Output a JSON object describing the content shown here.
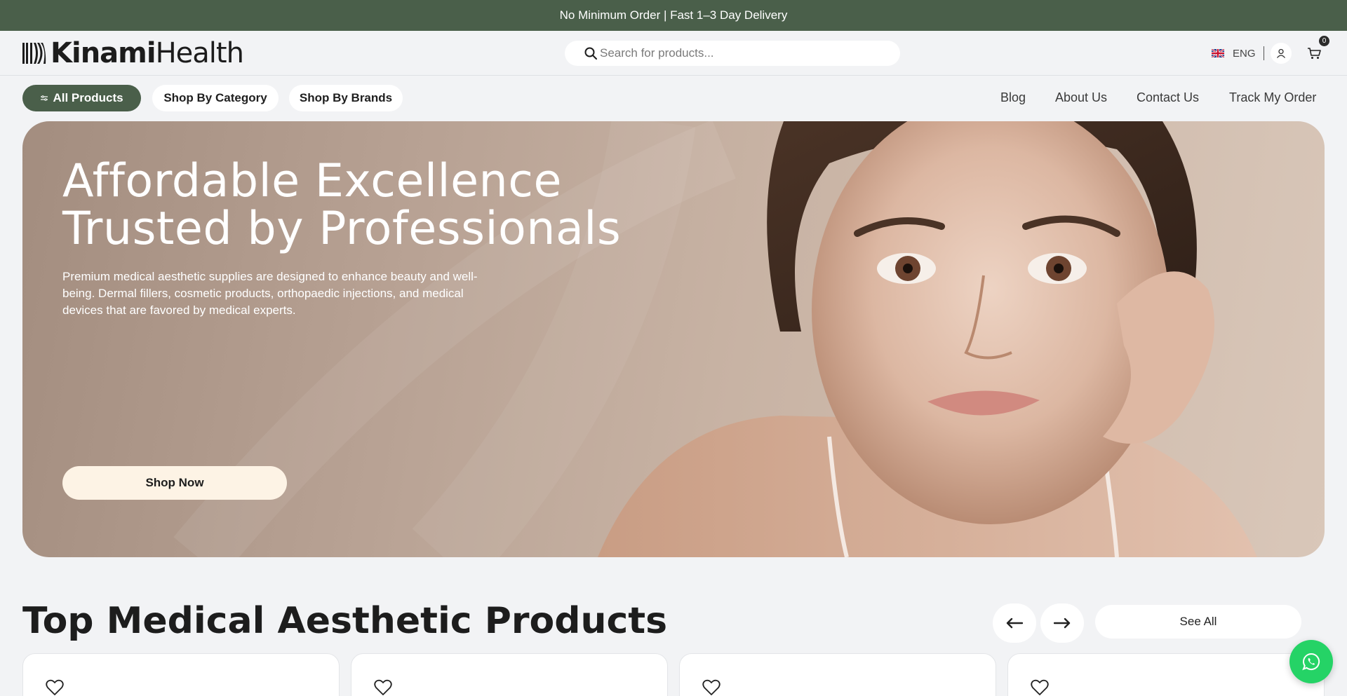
{
  "announcement": {
    "text": "No Minimum Order | Fast 1–3 Day Delivery"
  },
  "header": {
    "logo": {
      "bold": "Kinami",
      "regular": "Health"
    },
    "search": {
      "placeholder": "Search for products...",
      "value": ""
    },
    "language": {
      "label": "ENG",
      "flag_icon": "uk-flag-icon"
    },
    "user_icon": "user-icon",
    "cart": {
      "icon": "cart-icon",
      "count": "0"
    }
  },
  "nav": {
    "pills": [
      {
        "label": "All Products",
        "icon": "filter-icon",
        "active": true
      },
      {
        "label": "Shop By Category",
        "active": false
      },
      {
        "label": "Shop By Brands",
        "active": false
      }
    ],
    "links": [
      {
        "label": "Blog"
      },
      {
        "label": "About Us"
      },
      {
        "label": "Contact Us"
      },
      {
        "label": "Track My Order"
      }
    ]
  },
  "hero": {
    "title_line1": "Affordable Excellence",
    "title_line2": "Trusted by Professionals",
    "subtitle": "Premium medical aesthetic supplies are designed to enhance beauty and well-being. Dermal fillers, cosmetic products, orthopaedic injections, and medical devices that are favored by medical experts.",
    "cta_label": "Shop Now"
  },
  "products_section": {
    "title": "Top Medical Aesthetic Products",
    "prev_icon": "arrow-left-icon",
    "next_icon": "arrow-right-icon",
    "see_all_label": "See All",
    "card_icon": "heart-icon"
  },
  "floating": {
    "icon": "whatsapp-icon"
  },
  "colors": {
    "brand_green": "#4a5f4a",
    "background": "#f2f3f5",
    "cta_cream": "#fdf3e5",
    "whatsapp_green": "#25d366"
  }
}
